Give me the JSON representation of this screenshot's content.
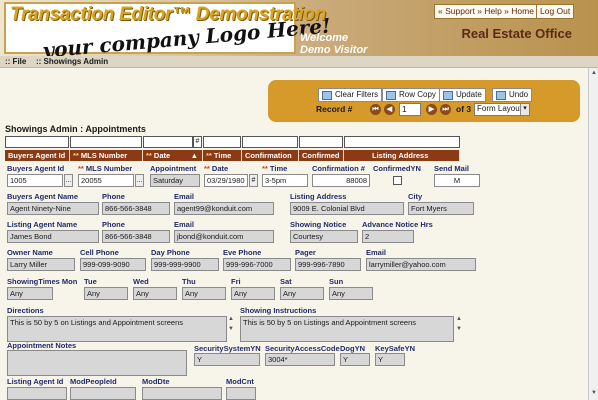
{
  "header": {
    "logo_title": "Transaction Editor™ Demonstration",
    "logo_tagline": "your company Logo Here!",
    "welcome_line1": "Welcome",
    "welcome_line2": "Demo Visitor",
    "office": "Real Estate Office",
    "top_links": "« Support » Help » Home",
    "logout": "Log Out"
  },
  "menu": {
    "file": ":: File",
    "showings_admin": ":: Showings Admin"
  },
  "toolbar": {
    "clear_filters": "Clear Filters",
    "row_copy": "Row Copy",
    "update": "Update",
    "undo": "Undo",
    "record_label": "Record #",
    "record_value": "1",
    "record_of": "of 3",
    "layout_select": "Form Layout"
  },
  "section_title": "Showings Admin :  Appointments",
  "filter_hash": "#",
  "columns": [
    {
      "label": "Buyers Agent Id",
      "req": false
    },
    {
      "label": "MLS Number",
      "req": true
    },
    {
      "label": "Date",
      "req": true,
      "sort": "▲"
    },
    {
      "label": "Time",
      "req": true
    },
    {
      "label": "Confirmation",
      "req": false
    },
    {
      "label": "Confirmed",
      "req": false
    },
    {
      "label": "Listing Address",
      "req": false
    }
  ],
  "form": {
    "buyers_agent_id": {
      "label": "Buyers Agent Id",
      "value": "1005"
    },
    "mls_number": {
      "label": "MLS Number",
      "value": "20055"
    },
    "appointment": {
      "label": "Appointment",
      "value": "Saturday"
    },
    "date": {
      "label": "Date",
      "value": "03/29/1980"
    },
    "time": {
      "label": "Time",
      "value": "3-5pm"
    },
    "confirmation": {
      "label": "Confirmation #",
      "value": "88008"
    },
    "confirmed_yn": {
      "label": "ConfirmedYN"
    },
    "send_mail": {
      "label": "Send Mail",
      "value": "M"
    },
    "buyers_agent_name": {
      "label": "Buyers Agent Name",
      "value": "Agent Ninety-Nine"
    },
    "buyers_phone": {
      "label": "Phone",
      "value": "866-566-3848"
    },
    "buyers_email": {
      "label": "Email",
      "value": "agent99@konduit.com"
    },
    "listing_address": {
      "label": "Listing Address",
      "value": "9009 E. Colonial Blvd"
    },
    "city": {
      "label": "City",
      "value": "Fort Myers"
    },
    "listing_agent_name": {
      "label": "Listing Agent Name",
      "value": "James Bond"
    },
    "listing_phone": {
      "label": "Phone",
      "value": "866-566-3848"
    },
    "listing_email": {
      "label": "Email",
      "value": "jbond@konduit.com"
    },
    "showing_notice": {
      "label": "Showing Notice",
      "value": "Courtesy"
    },
    "advance_notice": {
      "label": "Advance Notice Hrs",
      "value": "2"
    },
    "owner_name": {
      "label": "Owner Name",
      "value": "Larry Miller"
    },
    "cell_phone": {
      "label": "Cell Phone",
      "value": "999-099-9090"
    },
    "day_phone": {
      "label": "Day Phone",
      "value": "999-999-9900"
    },
    "eve_phone": {
      "label": "Eve Phone",
      "value": "999-996-7000"
    },
    "pager": {
      "label": "Pager",
      "value": "999-996-7890"
    },
    "owner_email": {
      "label": "Email",
      "value": "larrymiller@yahoo.com"
    },
    "days": [
      {
        "label": "ShowingTimes Mon",
        "value": "Any"
      },
      {
        "label": "Tue",
        "value": "Any"
      },
      {
        "label": "Wed",
        "value": "Any"
      },
      {
        "label": "Thu",
        "value": "Any"
      },
      {
        "label": "Fri",
        "value": "Any"
      },
      {
        "label": "Sat",
        "value": "Any"
      },
      {
        "label": "Sun",
        "value": "Any"
      }
    ],
    "directions": {
      "label": "Directions",
      "value": "This is 50 by 5 on Listings and Appointment screens"
    },
    "showing_instructions": {
      "label": "Showing Instructions",
      "value": "This is 50 by 5 on Listings and Appointment screens"
    },
    "appointment_notes": {
      "label": "Appointment Notes",
      "value": ""
    },
    "security_system": {
      "label": "SecuritySystemYN",
      "value": "Y"
    },
    "security_code": {
      "label": "SecurityAccessCode",
      "value": "3004*"
    },
    "dog": {
      "label": "DogYN",
      "value": "Y"
    },
    "keysafe": {
      "label": "KeySafeYN",
      "value": "Y"
    },
    "listing_agent_id": {
      "label": "Listing Agent Id"
    },
    "mod_people_id": {
      "label": "ModPeopleId"
    },
    "mod_dte": {
      "label": "ModDte"
    },
    "mod_cnt": {
      "label": "ModCnt"
    }
  }
}
